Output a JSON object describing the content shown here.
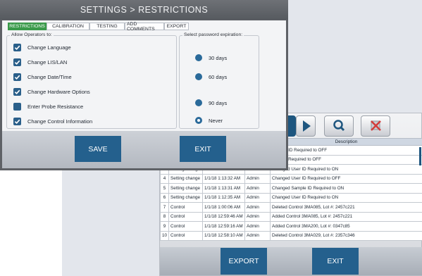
{
  "settings": {
    "title": "SETTINGS > RESTRICTIONS",
    "tabs": [
      "RESTRICTIONS",
      "CALIBRATION",
      "TESTING",
      "ADD COMMENTS",
      "EXPORT"
    ],
    "active_tab": "RESTRICTIONS",
    "operators_group": {
      "legend": "Allow Operators to:",
      "options": [
        {
          "label": "Change Language",
          "checked": true
        },
        {
          "label": "Change LIS/LAN",
          "checked": true
        },
        {
          "label": "Change Date/Time",
          "checked": true
        },
        {
          "label": "Change Hardware Options",
          "checked": true
        },
        {
          "label": "Enter Probe Resistance",
          "checked": false
        },
        {
          "label": "Change Control Information",
          "checked": true
        }
      ]
    },
    "password_group": {
      "legend": "Select password expiration:",
      "options": [
        {
          "label": "30 days",
          "selected": false
        },
        {
          "label": "60 days",
          "selected": false
        },
        {
          "label": "90 days",
          "selected": false
        },
        {
          "label": "Never",
          "selected": true
        }
      ]
    },
    "save_label": "SAVE",
    "exit_label": "EXIT"
  },
  "log": {
    "header": {
      "description": "Description"
    },
    "rows": [
      {
        "num": "",
        "type": "",
        "time": "",
        "user": "",
        "desc": "Sample ID Required to OFF"
      },
      {
        "num": "",
        "type": "",
        "time": "",
        "user": "",
        "desc": "User ID Required to OFF"
      },
      {
        "num": "3",
        "type": "Setting change",
        "time": "1/1/18 1:13:54 AM",
        "user": "Admin",
        "desc": "Changed User ID Required to ON"
      },
      {
        "num": "4",
        "type": "Setting change",
        "time": "1/1/18 1:13:32 AM",
        "user": "Admin",
        "desc": "Changed User ID Required to OFF"
      },
      {
        "num": "5",
        "type": "Setting change",
        "time": "1/1/18 1:13:31 AM",
        "user": "Admin",
        "desc": "Changed Sample ID Required to ON"
      },
      {
        "num": "6",
        "type": "Setting change",
        "time": "1/1/18 1:12:35 AM",
        "user": "Admin",
        "desc": "Changed User ID Required to ON"
      },
      {
        "num": "7",
        "type": "Control",
        "time": "1/1/18 1:00:06 AM",
        "user": "Admin",
        "desc": "Deleted Control 3MA085, Lot #: 2457c221"
      },
      {
        "num": "8",
        "type": "Control",
        "time": "1/1/18 12:59:46 AM",
        "user": "Admin",
        "desc": "Added Control 3MA085, Lot #: 2457c221"
      },
      {
        "num": "9",
        "type": "Control",
        "time": "1/1/18 12:59:16 AM",
        "user": "Admin",
        "desc": "Added Control 3MA200, Lot #: 0347c85"
      },
      {
        "num": "10",
        "type": "Control",
        "time": "1/1/18 12:58:10 AM",
        "user": "Admin",
        "desc": "Deleted Control 3MA029, Lot #: 2357c346"
      }
    ],
    "export_label": "EXPORT",
    "exit_label": "EXIT"
  },
  "colors": {
    "accent": "#24608d",
    "tab_active": "#3a9a4a",
    "checkbox": "#2a5f8a",
    "title_bar": "#5e6166"
  },
  "icons": {
    "toolbar": [
      "next-icon",
      "search-icon",
      "delete-icon"
    ],
    "checkbox": "checkmark-icon"
  }
}
